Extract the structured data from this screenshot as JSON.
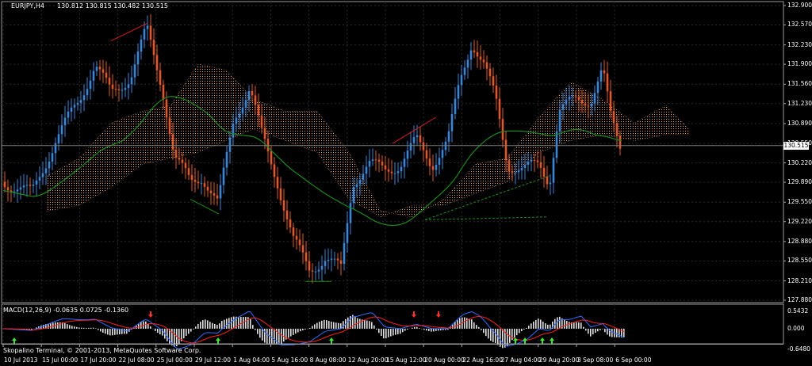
{
  "header": {
    "symbol_timeframe": "EURJPY,H4",
    "ohlc": "130.812 130.815 130.482 130.515"
  },
  "price_axis": {
    "labels": [
      "132.900",
      "132.570",
      "132.230",
      "131.900",
      "131.560",
      "131.230",
      "130.890",
      "130.550",
      "130.220",
      "129.890",
      "129.550",
      "129.220",
      "128.880",
      "128.550",
      "128.210",
      "127.880"
    ],
    "current_price": "130.515"
  },
  "macd_panel": {
    "title": "MACD(12,26,9) -0.0635 0.0725 -0.1360",
    "axis_labels": [
      "0.5432",
      "0.000",
      "-0.6480"
    ]
  },
  "time_axis": {
    "labels": [
      "10 Jul 2013",
      "15 Jul 00:00",
      "17 Jul 20:00",
      "22 Jul 08:00",
      "25 Jul 00:00",
      "29 Jul 12:00",
      "1 Aug 04:00",
      "5 Aug 16:00",
      "8 Aug 08:00",
      "12 Aug 20:00",
      "15 Aug 12:00",
      "20 Aug 00:00",
      "22 Aug 16:00",
      "27 Aug 04:00",
      "29 Aug 20:00",
      "3 Sep 08:00",
      "6 Sep 00:00"
    ]
  },
  "footer": {
    "copyright": "Skopalino Terminal, © 2001-2013, MetaQuotes Software Corp."
  },
  "colors": {
    "background": "#000000",
    "grid": "#2a2a2a",
    "bull_candle": "#3a86d8",
    "bear_candle": "#e2582a",
    "ma_fast": "#ff2020",
    "ma_slow": "#1f8a1f",
    "cloud": "#e0a070",
    "macd_hist": "#e0e0e0",
    "macd_main": "#2f6fff",
    "macd_signal": "#ff2020"
  }
}
